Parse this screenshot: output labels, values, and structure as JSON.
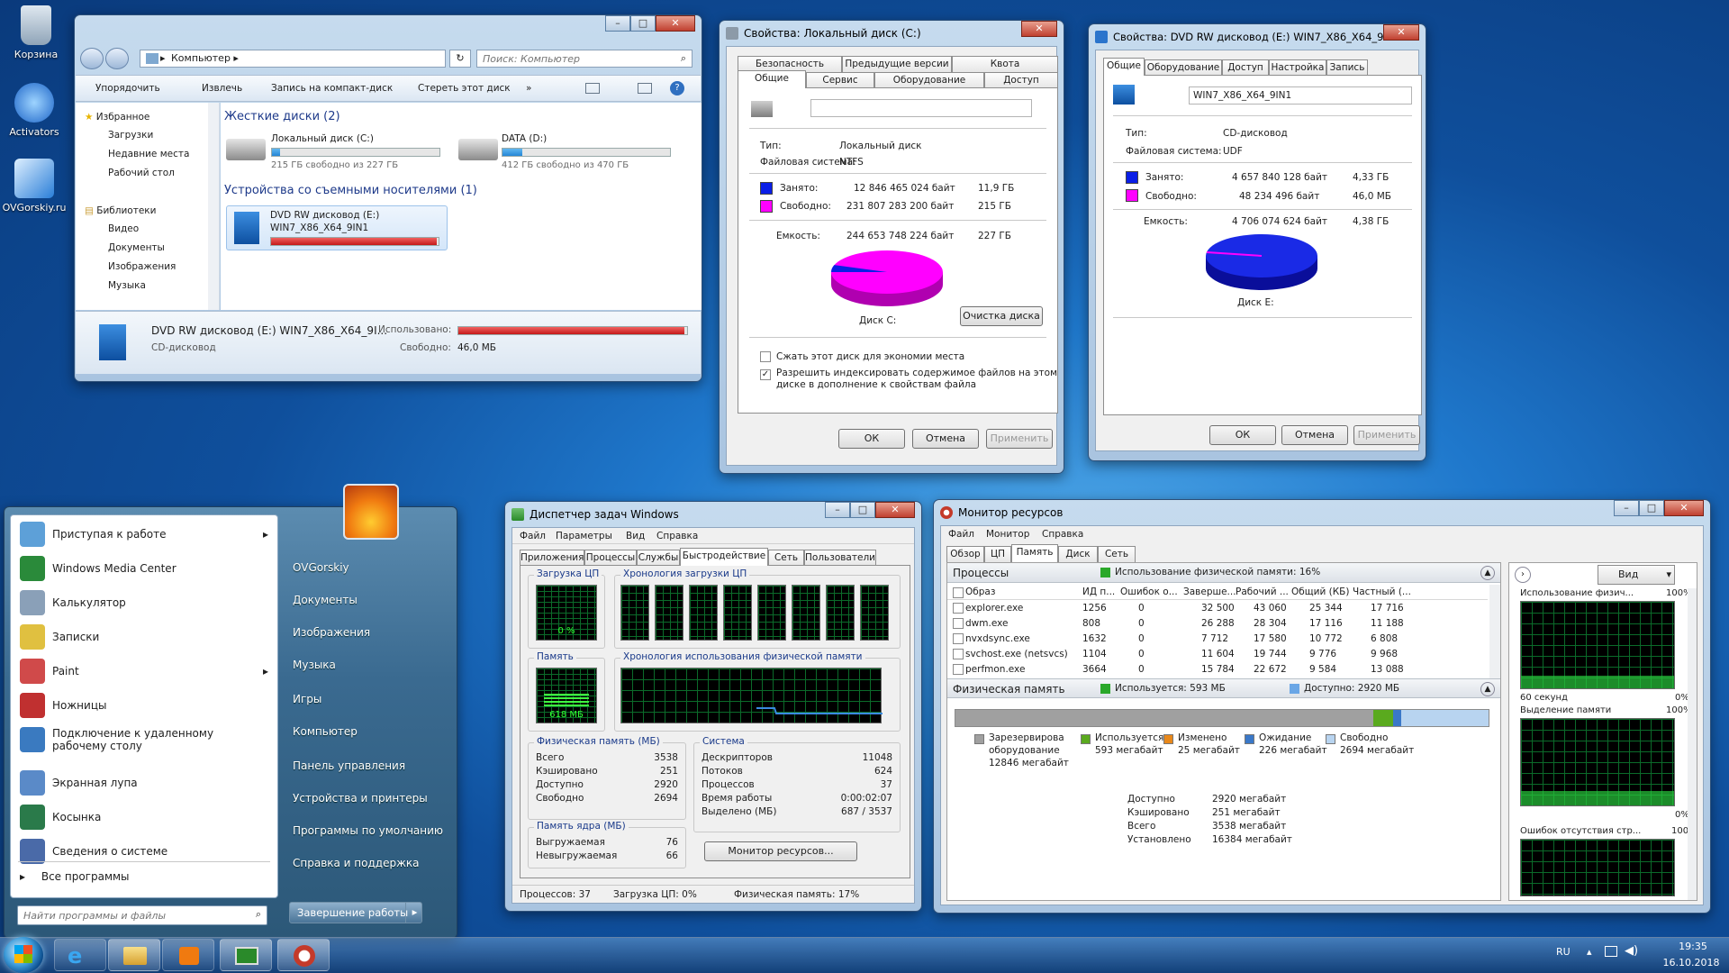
{
  "desktop": {
    "icons": [
      {
        "label": "Корзина"
      },
      {
        "label": "Activators"
      },
      {
        "label": "OVGorskiy.ru"
      }
    ]
  },
  "explorer": {
    "address_root": "Компьютер",
    "search_placeholder": "Поиск: Компьютер",
    "toolbar": [
      "Упорядочить",
      "Извлечь",
      "Запись на компакт-диск",
      "Стереть этот диск",
      "»"
    ],
    "nav": {
      "favorites": "Избранное",
      "fav_items": [
        "Загрузки",
        "Недавние места",
        "Рабочий стол"
      ],
      "libraries": "Библиотеки",
      "lib_items": [
        "Видео",
        "Документы",
        "Изображения",
        "Музыка"
      ]
    },
    "groups": {
      "hdd": "Жесткие диски (2)",
      "removable": "Устройства со съемными носителями (1)"
    },
    "drives": [
      {
        "name": "Локальный диск (C:)",
        "free": "215 ГБ свободно из 227 ГБ",
        "fill": 0.05
      },
      {
        "name": "DATA (D:)",
        "free": "412 ГБ свободно из 470 ГБ",
        "fill": 0.12
      }
    ],
    "dvd": {
      "name": "DVD RW дисковод (E:)",
      "label": "WIN7_X86_X64_9IN1",
      "fill": 0.99
    },
    "details": {
      "name": "DVD RW дисковод (E:) WIN7_X86_X64_9I...",
      "type": "CD-дисковод",
      "used_label": "Использовано:",
      "free_label": "Свободно:",
      "free_value": "46,0 МБ",
      "fill": 0.99
    }
  },
  "propC": {
    "title": "Свойства: Локальный диск (C:)",
    "tabs_top": [
      "Безопасность",
      "Предыдущие версии",
      "Квота"
    ],
    "tabs_bottom": [
      "Общие",
      "Сервис",
      "Оборудование",
      "Доступ"
    ],
    "type_label": "Тип:",
    "type_value": "Локальный диск",
    "fs_label": "Файловая система:",
    "fs_value": "NTFS",
    "used_label": "Занято:",
    "used_bytes": "12 846 465 024 байт",
    "used_gb": "11,9 ГБ",
    "free_label": "Свободно:",
    "free_bytes": "231 807 283 200 байт",
    "free_gb": "215 ГБ",
    "cap_label": "Емкость:",
    "cap_bytes": "244 653 748 224 байт",
    "cap_gb": "227 ГБ",
    "disk_label": "Диск C:",
    "cleanup": "Очистка диска",
    "compress": "Сжать этот диск для экономии места",
    "index1": "Разрешить индексировать содержимое файлов на этом",
    "index2": "диске в дополнение к свойствам файла",
    "ok": "ОК",
    "cancel": "Отмена",
    "apply": "Применить",
    "used_color": "#0a1ee6",
    "free_color": "#ff00ff",
    "used_fraction": 0.053
  },
  "propE": {
    "title": "Свойства: DVD RW дисковод (E:) WIN7_X86_X64_9IN1",
    "tabs": [
      "Общие",
      "Оборудование",
      "Доступ",
      "Настройка",
      "Запись"
    ],
    "label_value": "WIN7_X86_X64_9IN1",
    "type_label": "Тип:",
    "type_value": "CD-дисковод",
    "fs_label": "Файловая система:",
    "fs_value": "UDF",
    "used_label": "Занято:",
    "used_bytes": "4 657 840 128 байт",
    "used_gb": "4,33 ГБ",
    "free_label": "Свободно:",
    "free_bytes": "48 234 496 байт",
    "free_gb": "46,0 МБ",
    "cap_label": "Емкость:",
    "cap_bytes": "4 706 074 624 байт",
    "cap_gb": "4,38 ГБ",
    "disk_label": "Диск E:",
    "ok": "ОК",
    "cancel": "Отмена",
    "apply": "Применить",
    "used_fraction": 0.99
  },
  "taskmgr": {
    "title": "Диспетчер задач Windows",
    "menu": [
      "Файл",
      "Параметры",
      "Вид",
      "Справка"
    ],
    "tabs": [
      "Приложения",
      "Процессы",
      "Службы",
      "Быстродействие",
      "Сеть",
      "Пользователи"
    ],
    "cpu_label": "Загрузка ЦП",
    "cpu_value": "0 %",
    "cpu_hist_label": "Хронология загрузки ЦП",
    "mem_label": "Память",
    "mem_value": "618 МБ",
    "mem_hist_label": "Хронология использования физической памяти",
    "phys_title": "Физическая память (МБ)",
    "phys": [
      [
        "Всего",
        "3538"
      ],
      [
        "Кэшировано",
        "251"
      ],
      [
        "Доступно",
        "2920"
      ],
      [
        "Свободно",
        "2694"
      ]
    ],
    "sys_title": "Система",
    "sys": [
      [
        "Дескрипторов",
        "11048"
      ],
      [
        "Потоков",
        "624"
      ],
      [
        "Процессов",
        "37"
      ],
      [
        "Время работы",
        "0:00:02:07"
      ],
      [
        "Выделено (МБ)",
        "687 / 3537"
      ]
    ],
    "kernel_title": "Память ядра (МБ)",
    "kernel": [
      [
        "Выгружаемая",
        "76"
      ],
      [
        "Невыгружаемая",
        "66"
      ]
    ],
    "resmon_button": "Монитор ресурсов...",
    "status": [
      "Процессов: 37",
      "Загрузка ЦП: 0%",
      "Физическая память: 17%"
    ]
  },
  "resmon": {
    "title": "Монитор ресурсов",
    "menu": [
      "Файл",
      "Монитор",
      "Справка"
    ],
    "tabs": [
      "Обзор",
      "ЦП",
      "Память",
      "Диск",
      "Сеть"
    ],
    "proc_header": "Процессы",
    "proc_usage": "Использование физической памяти: 16%",
    "cols": [
      "Образ",
      "ИД п...",
      "Ошибок о...",
      "Заверше...",
      "Рабочий ...",
      "Общий (КБ)",
      "Частный (..."
    ],
    "rows": [
      [
        "explorer.exe",
        "1256",
        "0",
        "32 500",
        "43 060",
        "25 344",
        "17 716"
      ],
      [
        "dwm.exe",
        "808",
        "0",
        "26 288",
        "28 304",
        "17 116",
        "11 188"
      ],
      [
        "nvxdsync.exe",
        "1632",
        "0",
        "7 712",
        "17 580",
        "10 772",
        "6 808"
      ],
      [
        "svchost.exe (netsvcs)",
        "1104",
        "0",
        "11 604",
        "19 744",
        "9 776",
        "9 968"
      ],
      [
        "perfmon.exe",
        "3664",
        "0",
        "15 784",
        "22 672",
        "9 584",
        "13 088"
      ]
    ],
    "phys_header": "Физическая память",
    "phys_used": "Используется: 593 МБ",
    "phys_avail": "Доступно: 2920 МБ",
    "legend": [
      {
        "l1": "Зарезервирова",
        "l2": "оборудование",
        "l3": "12846 мегабайт",
        "color": "#a0a0a0"
      },
      {
        "l1": "Используется",
        "l2": "593 мегабайт",
        "color": "#5aaa1e"
      },
      {
        "l1": "Изменено",
        "l2": "25 мегабайт",
        "color": "#e8881a"
      },
      {
        "l1": "Ожидание",
        "l2": "226 мегабайт",
        "color": "#3a78c8"
      },
      {
        "l1": "Свободно",
        "l2": "2694 мегабайт",
        "color": "#b8d4f0"
      }
    ],
    "summary": [
      [
        "Доступно",
        "2920 мегабайт"
      ],
      [
        "Кэшировано",
        "251 мегабайт"
      ],
      [
        "Всего",
        "3538 мегабайт"
      ],
      [
        "Установлено",
        "16384 мегабайт"
      ]
    ],
    "view_button": "Вид",
    "g1_label": "Использование физич...",
    "g1_pct": "100%",
    "g1_time": "60 секунд",
    "g1_zero": "0%",
    "g2_label": "Выделение памяти",
    "g2_pct": "100%",
    "g2_zero": "0%",
    "g3_label": "Ошибок отсутствия стр...",
    "g3_val": "100"
  },
  "start": {
    "left": [
      "Приступая к работе",
      "Windows Media Center",
      "Калькулятор",
      "Записки",
      "Paint",
      "Ножницы",
      "Подключение к удаленному рабочему столу",
      "Экранная лупа",
      "Косынка",
      "Сведения о системе"
    ],
    "all_programs": "Все программы",
    "search_placeholder": "Найти программы и файлы",
    "right": [
      "OVGorskiy",
      "Документы",
      "Изображения",
      "Музыка",
      "Игры",
      "Компьютер",
      "Панель управления",
      "Устройства и принтеры",
      "Программы по умолчанию",
      "Справка и поддержка"
    ],
    "shutdown": "Завершение работы"
  },
  "taskbar": {
    "lang": "RU",
    "time": "19:35",
    "date": "16.10.2018"
  }
}
